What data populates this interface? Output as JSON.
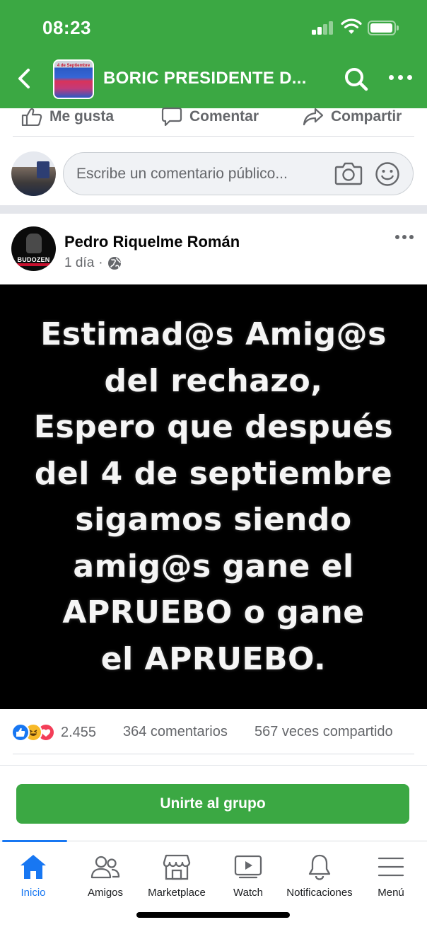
{
  "status_bar": {
    "time": "08:23"
  },
  "header": {
    "title": "BORIC PRESIDENTE D...",
    "thumbnail_text": "4 de Septiembre"
  },
  "actions": {
    "like": "Me gusta",
    "comment": "Comentar",
    "share": "Compartir"
  },
  "composer": {
    "placeholder": "Escribe un comentario público..."
  },
  "post": {
    "author": "Pedro Riquelme Román",
    "time": "1 día",
    "avatar_text": "BUDOZEN",
    "image_text": "Estimad@s Amig@s\ndel rechazo,\nEspero que después\ndel 4 de septiembre\nsigamos siendo\namig@s gane el\nAPRUEBO o gane\nel APRUEBO.",
    "reactions_count": "2.455",
    "comments": "364 comentarios",
    "shares": "567 veces compartido"
  },
  "join_button": "Unirte al grupo",
  "tabbar": {
    "tabs": [
      {
        "label": "Inicio",
        "icon": "home-icon",
        "active": true
      },
      {
        "label": "Amigos",
        "icon": "friends-icon"
      },
      {
        "label": "Marketplace",
        "icon": "marketplace-icon"
      },
      {
        "label": "Watch",
        "icon": "watch-icon"
      },
      {
        "label": "Notificaciones",
        "icon": "bell-icon"
      },
      {
        "label": "Menú",
        "icon": "menu-icon"
      }
    ]
  },
  "colors": {
    "header_green": "#3ba843",
    "facebook_blue": "#1877f2",
    "post_image_bg": "#000000"
  }
}
